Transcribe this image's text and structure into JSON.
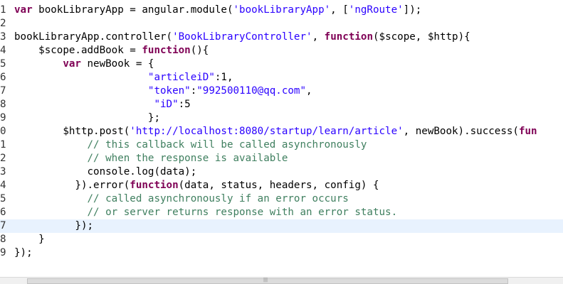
{
  "editor": {
    "lines": [
      {
        "num": "1",
        "segments": [
          {
            "t": "var",
            "c": "kw"
          },
          {
            "t": " bookLibraryApp = angular.module(",
            "c": "pl"
          },
          {
            "t": "'bookLibraryApp'",
            "c": "str"
          },
          {
            "t": ", [",
            "c": "pl"
          },
          {
            "t": "'ngRoute'",
            "c": "str"
          },
          {
            "t": "]);",
            "c": "pl"
          }
        ]
      },
      {
        "num": "2",
        "segments": []
      },
      {
        "num": "3",
        "segments": [
          {
            "t": "bookLibraryApp.controller(",
            "c": "pl"
          },
          {
            "t": "'BookLibraryController'",
            "c": "str"
          },
          {
            "t": ", ",
            "c": "pl"
          },
          {
            "t": "function",
            "c": "kw"
          },
          {
            "t": "($scope, $http){",
            "c": "pl"
          }
        ]
      },
      {
        "num": "4",
        "segments": [
          {
            "t": "    $scope.addBook = ",
            "c": "pl"
          },
          {
            "t": "function",
            "c": "kw"
          },
          {
            "t": "(){",
            "c": "pl"
          }
        ]
      },
      {
        "num": "5",
        "segments": [
          {
            "t": "        ",
            "c": "pl"
          },
          {
            "t": "var",
            "c": "kw"
          },
          {
            "t": " newBook = {",
            "c": "pl"
          }
        ]
      },
      {
        "num": "6",
        "segments": [
          {
            "t": "                      ",
            "c": "pl"
          },
          {
            "t": "\"articleiD\"",
            "c": "str"
          },
          {
            "t": ":1,",
            "c": "pl"
          }
        ]
      },
      {
        "num": "7",
        "segments": [
          {
            "t": "                      ",
            "c": "pl"
          },
          {
            "t": "\"token\"",
            "c": "str"
          },
          {
            "t": ":",
            "c": "pl"
          },
          {
            "t": "\"992500110@qq.com\"",
            "c": "str"
          },
          {
            "t": ",",
            "c": "pl"
          }
        ]
      },
      {
        "num": "8",
        "segments": [
          {
            "t": "                       ",
            "c": "pl"
          },
          {
            "t": "\"iD\"",
            "c": "str"
          },
          {
            "t": ":5",
            "c": "pl"
          }
        ]
      },
      {
        "num": "9",
        "segments": [
          {
            "t": "                      };",
            "c": "pl"
          }
        ]
      },
      {
        "num": "0",
        "segments": [
          {
            "t": "        $http.post(",
            "c": "pl"
          },
          {
            "t": "'http://localhost:8080/startup/learn/article'",
            "c": "str"
          },
          {
            "t": ", newBook).success(",
            "c": "pl"
          },
          {
            "t": "fun",
            "c": "kw"
          }
        ]
      },
      {
        "num": "1",
        "segments": [
          {
            "t": "            ",
            "c": "pl"
          },
          {
            "t": "// this callback will be called asynchronously",
            "c": "cmt"
          }
        ]
      },
      {
        "num": "2",
        "segments": [
          {
            "t": "            ",
            "c": "pl"
          },
          {
            "t": "// when the response is available",
            "c": "cmt"
          }
        ]
      },
      {
        "num": "3",
        "segments": [
          {
            "t": "            console.log(data);",
            "c": "pl"
          }
        ]
      },
      {
        "num": "4",
        "segments": [
          {
            "t": "          }).error(",
            "c": "pl"
          },
          {
            "t": "function",
            "c": "kw"
          },
          {
            "t": "(data, status, headers, config) {",
            "c": "pl"
          }
        ]
      },
      {
        "num": "5",
        "segments": [
          {
            "t": "            ",
            "c": "pl"
          },
          {
            "t": "// called asynchronously if an error occurs",
            "c": "cmt"
          }
        ]
      },
      {
        "num": "6",
        "segments": [
          {
            "t": "            ",
            "c": "pl"
          },
          {
            "t": "// or server returns response with an error status.",
            "c": "cmt"
          }
        ]
      },
      {
        "num": "7",
        "current": true,
        "segments": [
          {
            "t": "          });",
            "c": "pl"
          }
        ]
      },
      {
        "num": "8",
        "segments": [
          {
            "t": "    }",
            "c": "pl"
          }
        ]
      },
      {
        "num": "9",
        "segments": [
          {
            "t": "});",
            "c": "pl"
          }
        ]
      }
    ]
  },
  "scrollbar": {
    "grip_glyph": "|||"
  },
  "colors": {
    "keyword": "#7f0055",
    "string": "#2a00ff",
    "comment": "#3f7f5f",
    "current_line": "#e8f2fe"
  }
}
